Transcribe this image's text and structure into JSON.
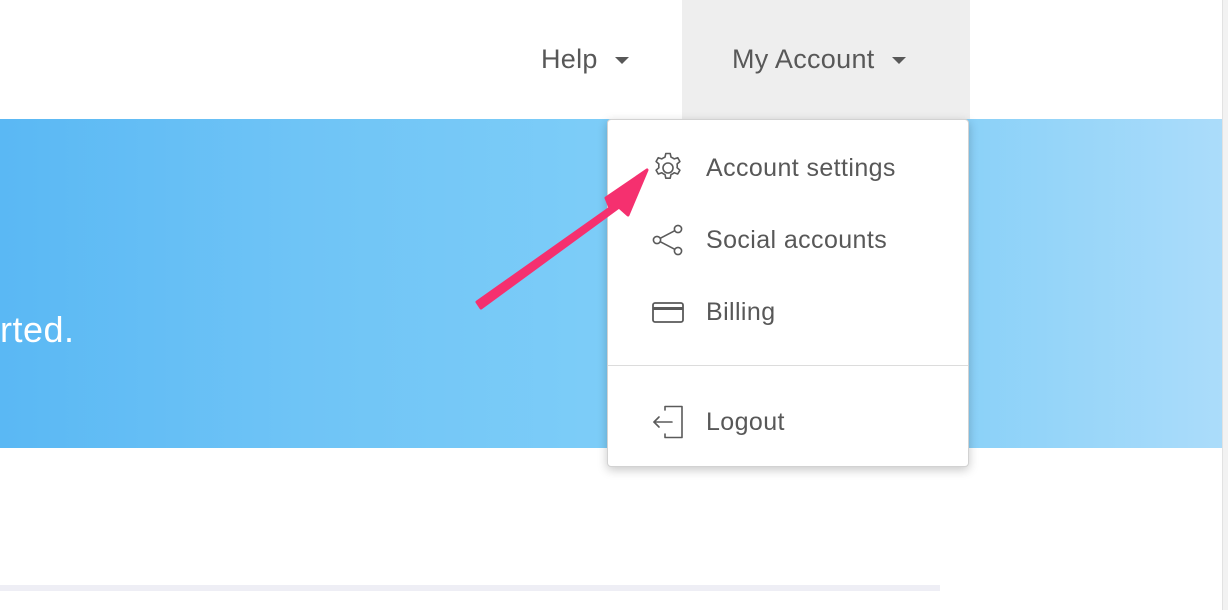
{
  "nav": {
    "help_label": "Help",
    "account_label": "My Account"
  },
  "hero": {
    "text": "rted."
  },
  "dropdown": {
    "items": [
      {
        "label": "Account settings",
        "icon": "gear-icon"
      },
      {
        "label": "Social accounts",
        "icon": "share-icon"
      },
      {
        "label": "Billing",
        "icon": "credit-card-icon"
      },
      {
        "label": "Logout",
        "icon": "logout-icon"
      }
    ]
  },
  "colors": {
    "hero_start": "#5ab8f4",
    "hero_end": "#abdcfa",
    "nav_active_bg": "#eeeeee",
    "text": "#585858",
    "annotation_arrow": "#f5306f"
  }
}
